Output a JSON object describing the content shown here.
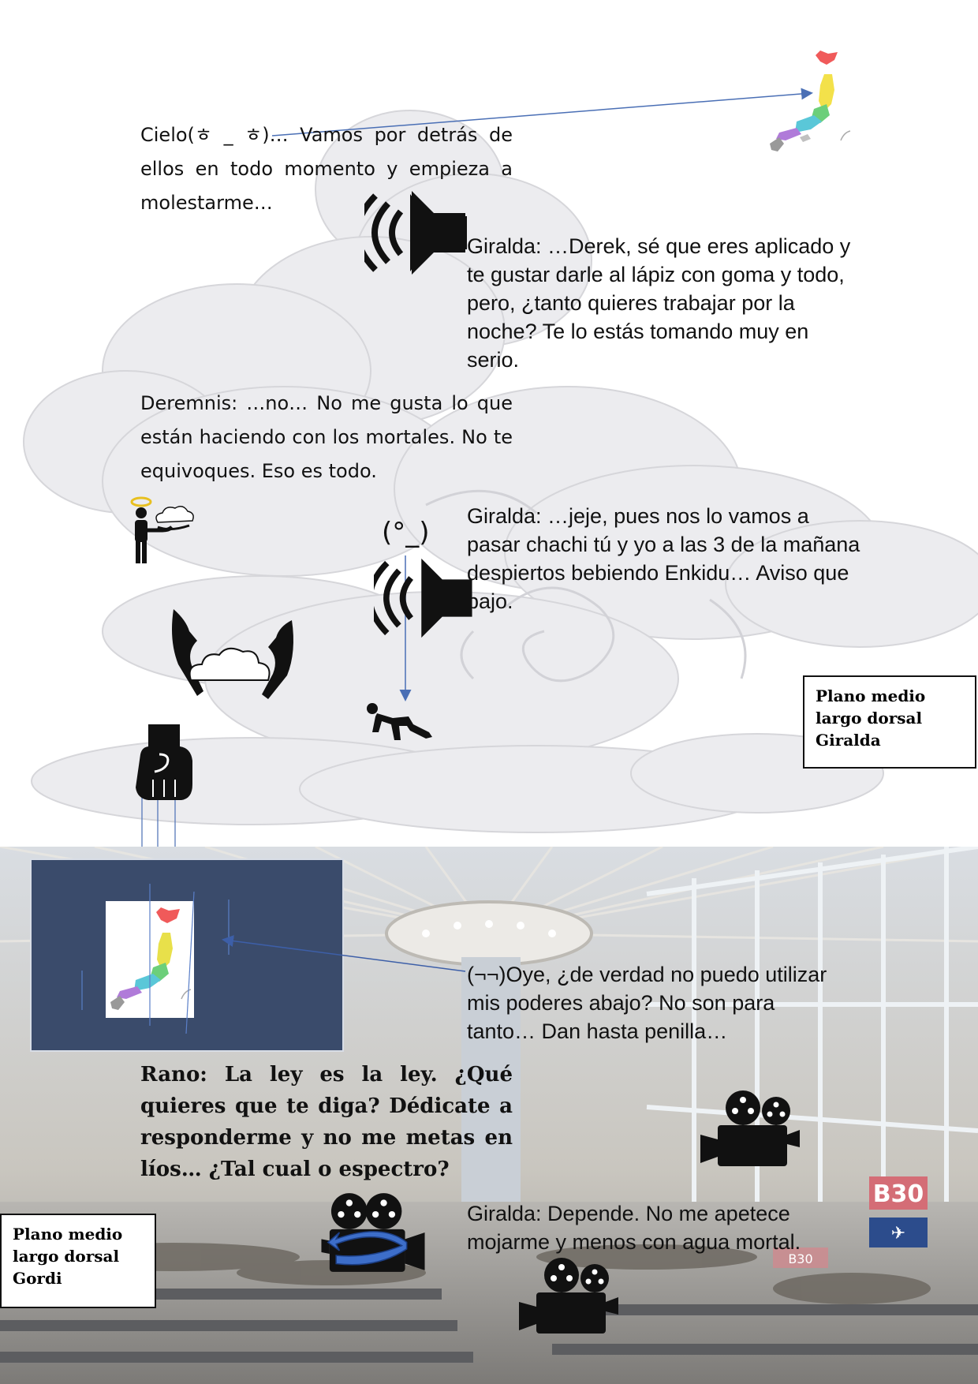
{
  "texts": {
    "cielo": "Cielo(ㅎ _ ㅎ)… Vamos por detrás de ellos en todo momento y empieza a molestarme…",
    "giralda1": "Giralda: …Derek, sé que eres aplicado y te gustar darle al lápiz con goma y todo, pero, ¿tanto quieres trabajar por la noche? Te lo estás tomando muy en serio.",
    "deremnis": "Deremnis: …no… No me gusta lo que están haciendo con los mortales. No te equivoques. Eso es todo.",
    "giralda2": "Giralda: …jeje, pues nos lo vamos a pasar chachi tú y yo a las 3 de la mañana despiertos bebiendo Enkidu… Aviso que bajo.",
    "oye": "(¬¬)Oye, ¿de verdad no puedo utilizar mis poderes abajo? No son para tanto… Dan hasta penilla…",
    "rano": "Rano: La ley es la ley. ¿Qué quieres que te diga? Dédicate a responderme y no me metas en líos… ¿Tal cual o espectro?",
    "giralda3": "Giralda: Depende. No me apetece mojarme y menos con agua mortal.",
    "kaomoji": "(°_)"
  },
  "labels": {
    "plano_giralda": "Plano medio\nlargo dorsal\nGiralda",
    "plano_gordi": "Plano medio\nlargo dorsal\nGordi"
  },
  "sign": {
    "gate": "B30",
    "gate_small": "B30"
  },
  "icons": [
    "japan-map-icon",
    "speaker-icon",
    "angel-cloud-icon",
    "hands-cloud-icon",
    "fist-icon",
    "crawling-person-icon",
    "movie-camera-icon"
  ],
  "colors": {
    "navy_panel": "#3a4b6b",
    "arrow": "#4a6fb5",
    "cloud": "#e9e9ec",
    "blue_arrow_fill": "#3d6ec9"
  }
}
